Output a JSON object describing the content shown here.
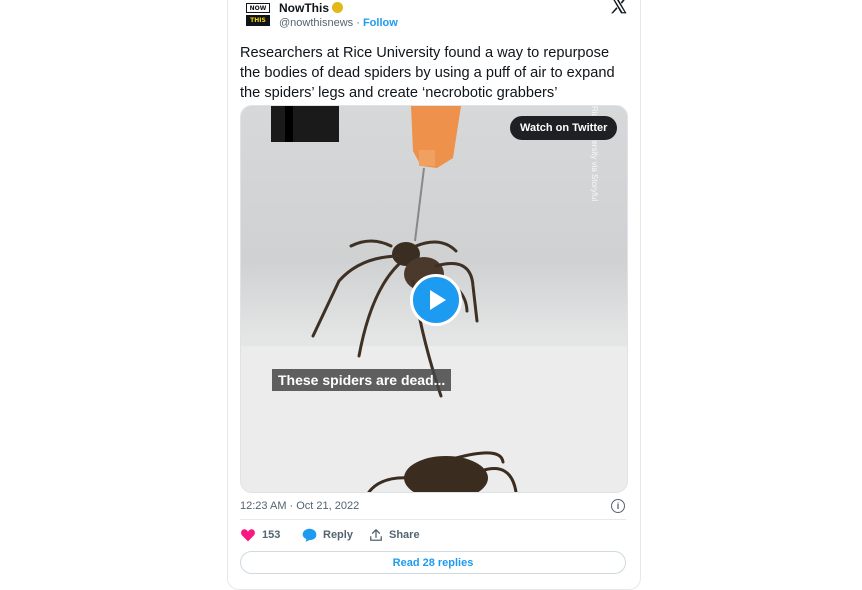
{
  "account": {
    "logo_top": "NOW",
    "logo_bottom": "THIS",
    "name": "NowThis",
    "handle": "@nowthisnews",
    "separator": "·",
    "follow_label": "Follow"
  },
  "tweet": {
    "text": "Researchers at Rice University found a way to repurpose the bodies of dead spiders by using a puff of air to expand the spiders’ legs and create ‘necrobotic grabbers’",
    "timestamp": "12:23 AM · Oct 21, 2022"
  },
  "media": {
    "watch_label": "Watch on Twitter",
    "credit": "Rice University via Storyful",
    "caption": "These spiders are dead..."
  },
  "actions": {
    "like_count": "153",
    "reply_label": "Reply",
    "share_label": "Share"
  },
  "footer": {
    "read_replies_label": "Read 28 replies"
  },
  "colors": {
    "accent": "#1d9bf0",
    "like": "#f91880",
    "verified": "#e2b719"
  },
  "icons": [
    "x-logo-icon",
    "verified-badge-icon",
    "play-icon",
    "info-icon",
    "heart-icon",
    "reply-bubble-icon",
    "share-icon"
  ]
}
